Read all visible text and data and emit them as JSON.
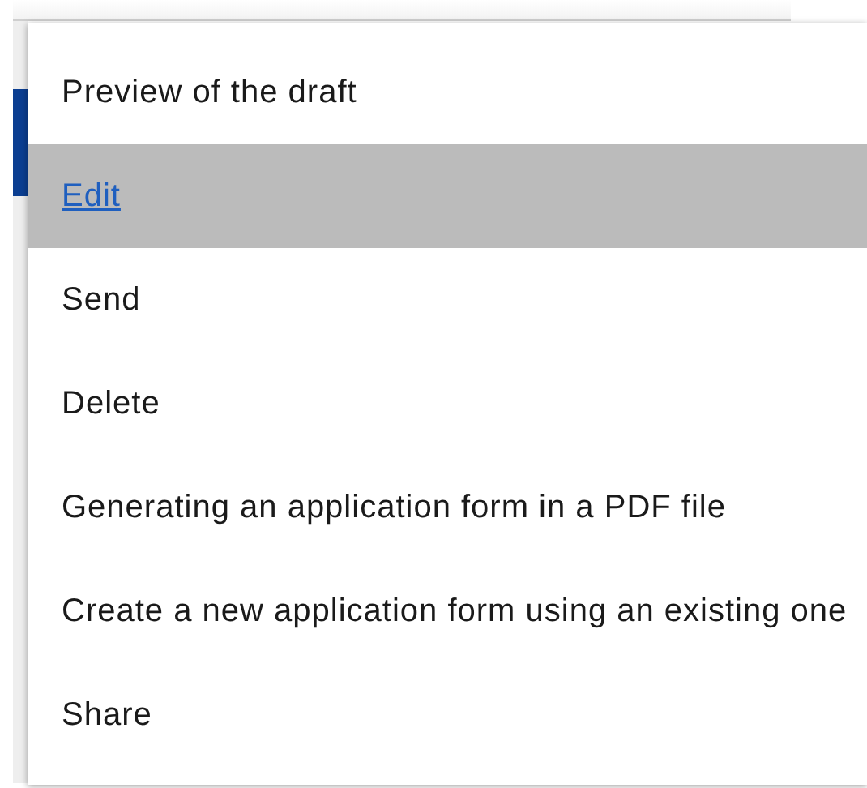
{
  "menu": {
    "items": [
      {
        "label": "Preview of the draft",
        "selected": false
      },
      {
        "label": "Edit",
        "selected": true
      },
      {
        "label": "Send",
        "selected": false
      },
      {
        "label": "Delete",
        "selected": false
      },
      {
        "label": "Generating an application form in a PDF file",
        "selected": false
      },
      {
        "label": "Create a new application form using an existing one",
        "selected": false
      },
      {
        "label": "Share",
        "selected": false
      }
    ]
  }
}
